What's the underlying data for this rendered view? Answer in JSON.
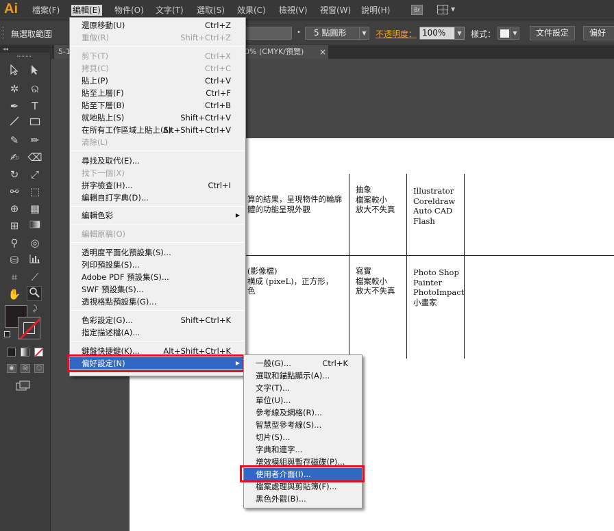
{
  "app": {
    "logo": "Ai"
  },
  "menubar": {
    "items": [
      "檔案(F)",
      "編輯(E)",
      "物件(O)",
      "文字(T)",
      "選取(S)",
      "效果(C)",
      "檢視(V)",
      "視窗(W)",
      "說明(H)"
    ],
    "bridge_label": "Br"
  },
  "controlbar": {
    "selection_status": "無選取範圍",
    "brush_dot": "•",
    "brush_value": "5 點圓形",
    "opacity_label": "不透明度：",
    "opacity_value": "100%",
    "style_label": "樣式：",
    "document_setup_button": "文件設定",
    "preferences_button": "偏好"
  },
  "tools_panel": {
    "collapse_glyph": "◂◂"
  },
  "document": {
    "tab_title": "5-1",
    "tab_title_rest": "0% (CMYK/預覽)",
    "tab_close": "×"
  },
  "artboard_table": {
    "row1": {
      "description": "算的結果，呈現物件的輪廓\n體的功能呈現外觀",
      "traits": "抽象\n檔案較小\n放大不失真",
      "software": "Illustrator\nCoreldraw\nAuto CAD\nFlash"
    },
    "row2": {
      "description": "(影像檔)\n構成 (pixeL)，正方形，\n色",
      "traits": "寫實\n檔案較小\n放大不失真",
      "software": "Photo Shop\nPainter\nPhotoImpact\n小畫家"
    }
  },
  "edit_menu": {
    "undo": {
      "label": "還原移動(U)",
      "shortcut": "Ctrl+Z"
    },
    "redo": {
      "label": "重做(R)",
      "shortcut": "Shift+Ctrl+Z"
    },
    "cut": {
      "label": "剪下(T)",
      "shortcut": "Ctrl+X"
    },
    "copy": {
      "label": "拷貝(C)",
      "shortcut": "Ctrl+C"
    },
    "paste": {
      "label": "貼上(P)",
      "shortcut": "Ctrl+V"
    },
    "paste_front": {
      "label": "貼至上層(F)",
      "shortcut": "Ctrl+F"
    },
    "paste_back": {
      "label": "貼至下層(B)",
      "shortcut": "Ctrl+B"
    },
    "paste_in_place": {
      "label": "就地貼上(S)",
      "shortcut": "Shift+Ctrl+V"
    },
    "paste_all_artboards": {
      "label": "在所有工作區域上貼上(S)",
      "shortcut": "Alt+Shift+Ctrl+V"
    },
    "clear": {
      "label": "清除(L)"
    },
    "find_replace": {
      "label": "尋找及取代(E)..."
    },
    "find_next": {
      "label": "找下一個(X)"
    },
    "spell_check": {
      "label": "拼字檢查(H)...",
      "shortcut": "Ctrl+I"
    },
    "custom_dictionary": {
      "label": "編輯自訂字典(D)..."
    },
    "edit_colors": {
      "label": "編輯色彩"
    },
    "edit_original": {
      "label": "編輯原稿(O)"
    },
    "transparency_presets": {
      "label": "透明度平面化預設集(S)..."
    },
    "print_presets": {
      "label": "列印預設集(S)..."
    },
    "pdf_presets": {
      "label": "Adobe PDF 預設集(S)..."
    },
    "swf_presets": {
      "label": "SWF 預設集(S)..."
    },
    "perspective_presets": {
      "label": "透視格點預設集(G)..."
    },
    "color_settings": {
      "label": "色彩設定(G)...",
      "shortcut": "Shift+Ctrl+K"
    },
    "assign_profile": {
      "label": "指定描述檔(A)..."
    },
    "keyboard_shortcuts": {
      "label": "鍵盤快捷鍵(K)...",
      "shortcut": "Alt+Shift+Ctrl+K"
    },
    "preferences": {
      "label": "偏好設定(N)"
    }
  },
  "preferences_menu": {
    "general": {
      "label": "一般(G)...",
      "shortcut": "Ctrl+K"
    },
    "selection_anchor": {
      "label": "選取和錨點顯示(A)..."
    },
    "type": {
      "label": "文字(T)..."
    },
    "units": {
      "label": "單位(U)..."
    },
    "guides_grid": {
      "label": "參考線及網格(R)..."
    },
    "smart_guides": {
      "label": "智慧型參考線(S)..."
    },
    "slices": {
      "label": "切片(S)..."
    },
    "dictionary_hyphenation": {
      "label": "字典和連字..."
    },
    "plugins_scratch": {
      "label": "增效模組與暫存磁碟(P)..."
    },
    "user_interface": {
      "label": "使用者介面(I)..."
    },
    "file_handling": {
      "label": "檔案處理與剪貼簿(F)..."
    },
    "black_appearance": {
      "label": "黑色外觀(B)..."
    }
  },
  "colors": {
    "accent_orange": "#f29a1d",
    "menu_highlight": "#3168c5",
    "annotation_red": "#e01020"
  }
}
